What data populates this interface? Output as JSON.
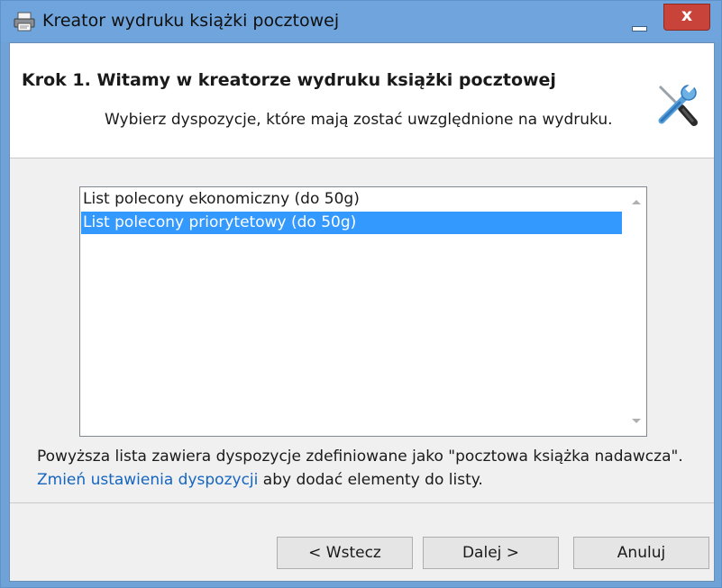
{
  "window": {
    "title": "Kreator wydruku książki pocztowej",
    "close_glyph": "x"
  },
  "header": {
    "step_title": "Krok 1. Witamy w kreatorze wydruku książki pocztowej",
    "subtitle": "Wybierz dyspozycje, które mają zostać uwzględnione na wydruku.",
    "icon": "tools-icon"
  },
  "list": {
    "items": [
      {
        "label": "List polecony ekonomiczny (do 50g)",
        "selected": false
      },
      {
        "label": "List polecony priorytetowy (do 50g)",
        "selected": true
      }
    ]
  },
  "info": {
    "line1": "Powyższa lista zawiera dyspozycje zdefiniowane jako \"pocztowa książka nadawcza\".",
    "link_text": "Zmień ustawienia dyspozycji",
    "line2_rest": " aby dodać elementy do listy."
  },
  "buttons": {
    "back": "< Wstecz",
    "next": "Dalej >",
    "cancel": "Anuluj"
  },
  "colors": {
    "selection": "#3399ff",
    "link": "#1565c0",
    "close_button": "#c8443a",
    "titlebar": "#6fa5dc"
  }
}
